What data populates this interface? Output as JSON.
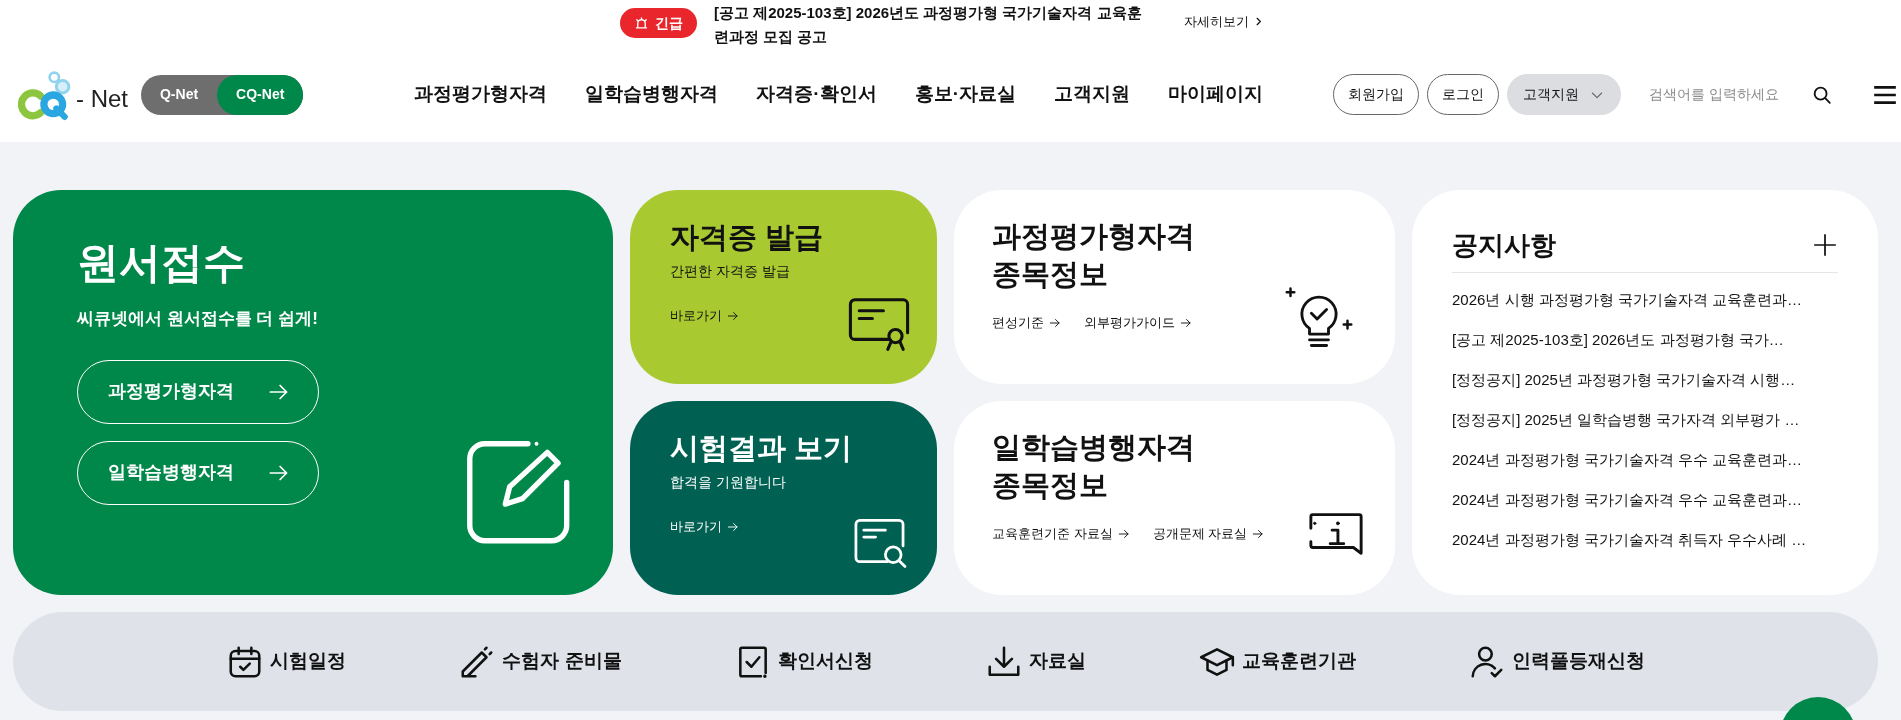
{
  "alert": {
    "badge": "긴급",
    "text": "[공고 제2025-103호] 2026년도 과정평가형 국가기술자격 교육훈련과정 모집 공고",
    "more": "자세히보기"
  },
  "logo": {
    "text": "- Net"
  },
  "site_toggle": [
    {
      "label": "Q-Net",
      "selected": false
    },
    {
      "label": "CQ-Net",
      "selected": true
    }
  ],
  "nav": [
    "과정평가형자격",
    "일학습병행자격",
    "자격증·확인서",
    "홍보·자료실",
    "고객지원",
    "마이페이지"
  ],
  "header_buttons": [
    {
      "label": "회원가입",
      "kind": "outline"
    },
    {
      "label": "로그인",
      "kind": "outline"
    },
    {
      "label": "고객지원",
      "kind": "dropdown"
    }
  ],
  "search": {
    "placeholder": "검색어를 입력하세요"
  },
  "apply_card": {
    "title": "원서접수",
    "subtitle": "씨큐넷에서 원서접수를 더 쉽게!",
    "buttons": [
      "과정평가형자격",
      "일학습병행자격"
    ]
  },
  "tiles": [
    {
      "kind": "certificate",
      "title": "자격증 발급",
      "subtitle": "간편한 자격증 발급",
      "link": "바로가기",
      "color": "#a9c931"
    },
    {
      "kind": "results",
      "title": "시험결과 보기",
      "subtitle": "합격을 기원합니다",
      "link": "바로가기",
      "color": "#006152"
    }
  ],
  "info_cards": [
    {
      "kind": "bulb",
      "title": "과정평가형자격 종목정보",
      "links": [
        "편성기준",
        "외부평가가이드"
      ]
    },
    {
      "kind": "info",
      "title": "일학습병행자격 종목정보",
      "links": [
        "교육훈련기준 자료실",
        "공개문제 자료실"
      ]
    }
  ],
  "notices": {
    "title": "공지사항",
    "items": [
      "2026년 시행 과정평가형 국가기술자격 교육훈련과…",
      "[공고 제2025-103호] 2026년도 과정평가형 국가…",
      "[정정공지] 2025년 과정평가형 국가기술자격 시행…",
      "[정정공지] 2025년 일학습병행 국가자격 외부평가 …",
      "2024년 과정평가형 국가기술자격 우수 교육훈련과…",
      "2024년 과정평가형 국가기술자격 우수 교육훈련과…",
      "2024년 과정평가형 국가기술자격 취득자 우수사례 …"
    ]
  },
  "quick_links": [
    {
      "kind": "calendar",
      "label": "시험일정"
    },
    {
      "kind": "pencil",
      "label": "수험자 준비물"
    },
    {
      "kind": "check",
      "label": "확인서신청"
    },
    {
      "kind": "download",
      "label": "자료실"
    },
    {
      "kind": "cap",
      "label": "교육훈련기관"
    },
    {
      "kind": "person",
      "label": "인력풀등재신청"
    }
  ]
}
